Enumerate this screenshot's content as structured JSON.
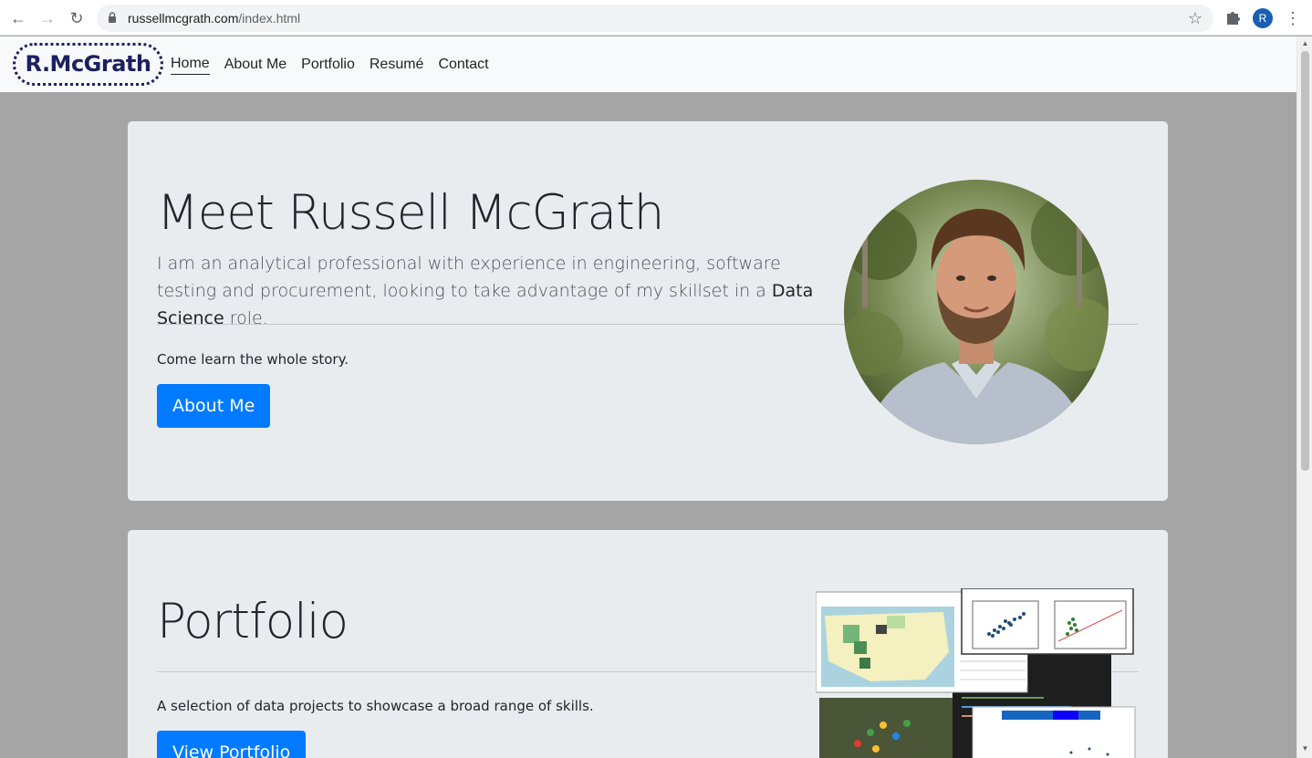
{
  "browser": {
    "url_host": "russellmcgrath.com",
    "url_path": "/index.html",
    "profile_initial": "R"
  },
  "nav": {
    "brand": "R.McGrath",
    "links": [
      "Home",
      "About Me",
      "Portfolio",
      "Resumé",
      "Contact"
    ],
    "active": "Home"
  },
  "hero": {
    "title": "Meet Russell McGrath",
    "lead_before": "I am an analytical professional with experience in engineering, software testing and procurement, looking to take advantage of my skillset in a ",
    "lead_strong": "Data Science",
    "lead_after": " role.",
    "sub": "Come learn the whole story.",
    "button": "About Me"
  },
  "portfolio": {
    "title": "Portfolio",
    "sub": "A selection of data projects to showcase a broad range of skills.",
    "button": "View Portfolio"
  },
  "colors": {
    "page_bg": "#a5a5a5",
    "card_bg": "#e9ecef",
    "primary": "#007bff",
    "brand": "#1c2060"
  }
}
